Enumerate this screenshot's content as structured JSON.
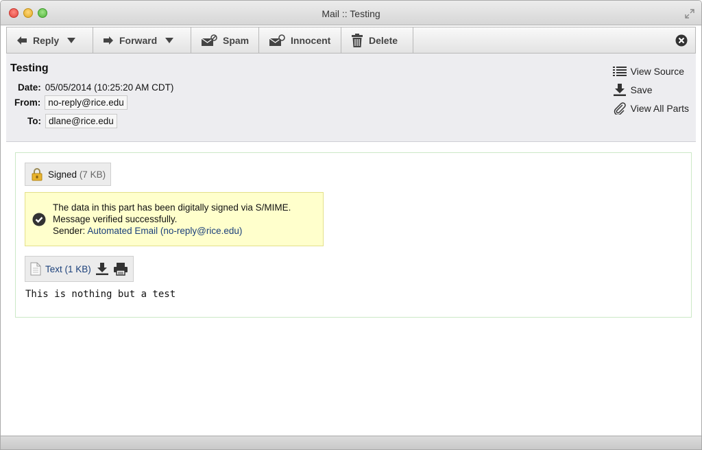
{
  "window": {
    "title": "Mail :: Testing"
  },
  "toolbar": {
    "reply_label": "Reply",
    "forward_label": "Forward",
    "spam_label": "Spam",
    "innocent_label": "Innocent",
    "delete_label": "Delete"
  },
  "header": {
    "subject": "Testing",
    "date_label": "Date:",
    "date_value": "05/05/2014 (10:25:20 AM CDT)",
    "from_label": "From:",
    "from_value": "no-reply@rice.edu",
    "to_label": "To:",
    "to_value": "dlane@rice.edu"
  },
  "actions": {
    "view_source": "View Source",
    "save": "Save",
    "view_all_parts": "View All Parts"
  },
  "parts": {
    "signed_label": "Signed",
    "signed_size": "(7 KB)",
    "smime_line1": "The data in this part has been digitally signed via S/MIME.",
    "smime_line2": "Message verified successfully.",
    "smime_sender_label": "Sender:",
    "smime_sender_value": "Automated Email (no-reply@rice.edu)",
    "text_label": "Text",
    "text_size": "(1 KB)"
  },
  "message": {
    "body": "This is nothing but a test"
  }
}
